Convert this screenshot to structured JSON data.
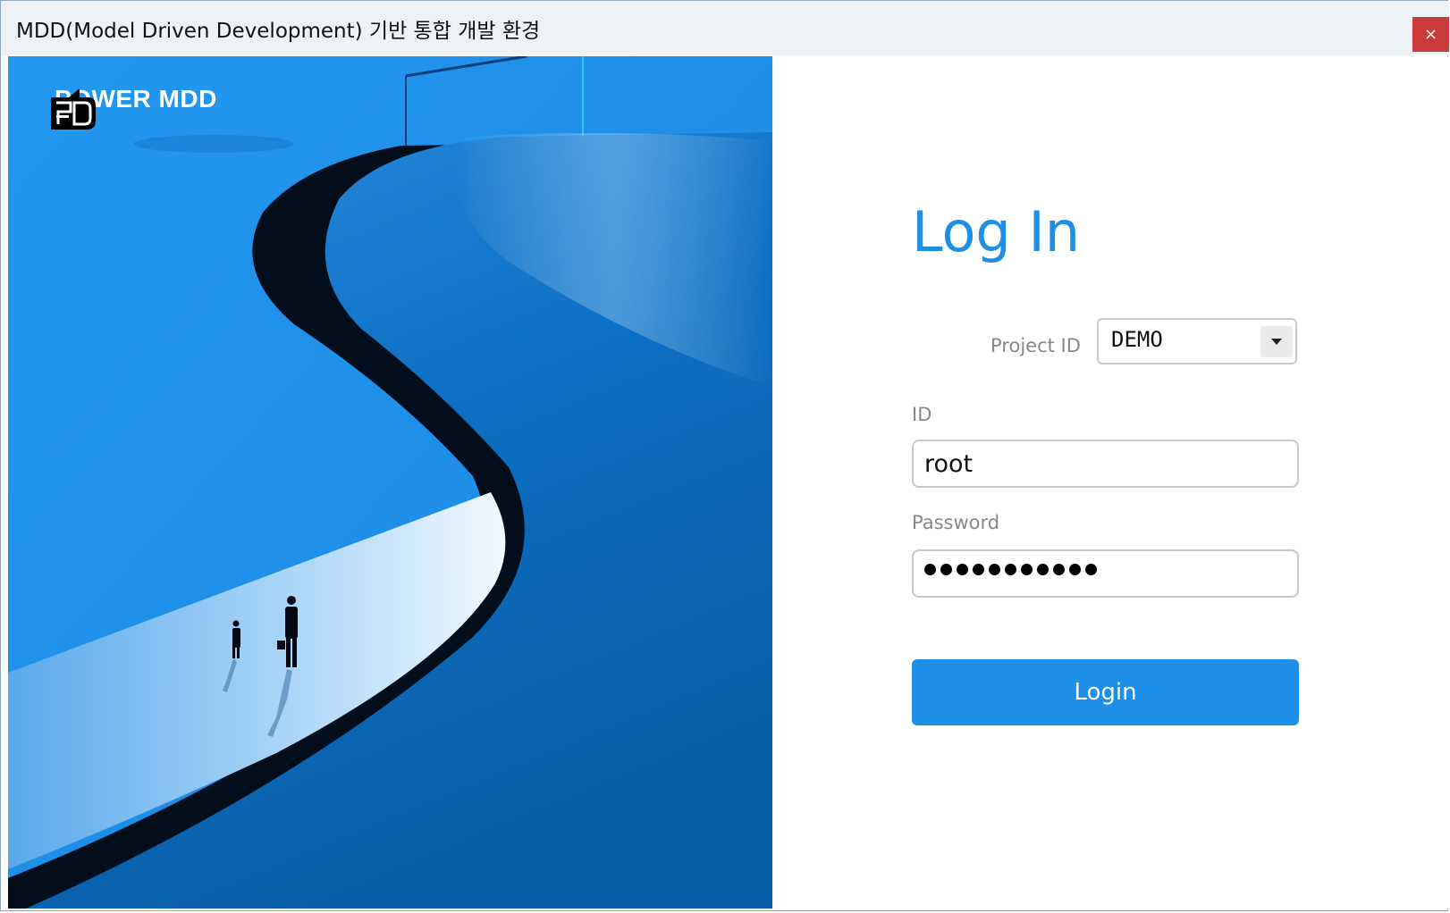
{
  "window": {
    "title": "MDD(Model Driven Development) 기반 통합 개발 환경",
    "close_glyph": "×"
  },
  "hero": {
    "logo_text": "POWER MDD",
    "logo_icon": "power-mdd-logo-mark",
    "colors": {
      "sky": "#2291ea",
      "road": "#0b6cbf",
      "road_shadow": "#020e1c",
      "light_path": "#8fcaf5"
    }
  },
  "login": {
    "heading": "Log In",
    "project_label": "Project ID",
    "project_value": "DEMO",
    "id_label": "ID",
    "id_value": "root",
    "password_label": "Password",
    "password_masked_count": 11,
    "button_label": "Login",
    "accent_color": "#1e8fe6"
  }
}
